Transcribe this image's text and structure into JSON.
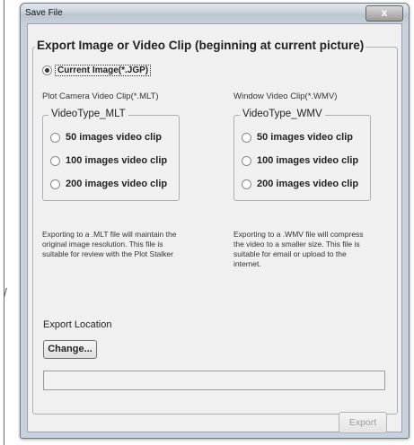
{
  "window": {
    "title": "Save File",
    "close_glyph": "x"
  },
  "group": {
    "legend": "Export Image or Video Clip (beginning at current picture)",
    "current_image_label": "Current Image(*.JGP)"
  },
  "mlt": {
    "column_title": "Plot Camera Video Clip(*.MLT)",
    "legend": "VideoType_MLT",
    "options": [
      "50 images video clip",
      "100 images video clip",
      "200 images video clip"
    ],
    "description": "Exporting to a .MLT file will maintain the original image resolution. This file is suitable for review with the Plot Stalker"
  },
  "wmv": {
    "column_title": "Window Video Clip(*.WMV)",
    "legend": "VideoType_WMV",
    "options": [
      "50 images video clip",
      "100 images video clip",
      "200 images video clip"
    ],
    "description": "Exporting to a .WMV file will compress the video to a smaller size.  This file is suitable for email or upload to the internet."
  },
  "export": {
    "location_label": "Export Location",
    "change_button": "Change...",
    "path_value": "",
    "export_button": "Export"
  },
  "side_mark": "/",
  "icons": {
    "close": "close-icon",
    "radio": "radio-icon"
  }
}
